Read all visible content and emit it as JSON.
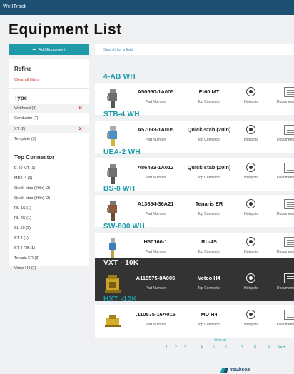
{
  "app": {
    "title": "WellTrack"
  },
  "page": {
    "title": "Equipment List"
  },
  "actions": {
    "add_label": "Add Equipment"
  },
  "search": {
    "placeholder": "Search for a field"
  },
  "refine": {
    "title": "Refine",
    "clear_label": "Clear all filters",
    "type": {
      "title": "Type",
      "items": [
        {
          "label": "Wellhead (8)",
          "selected": true
        },
        {
          "label": "Conductor (7)",
          "selected": false
        },
        {
          "label": "XT (2)",
          "selected": true
        },
        {
          "label": "Template (3)",
          "selected": false
        }
      ]
    },
    "top_connector": {
      "title": "Top Connector",
      "items": [
        "E-60 MT (1)",
        "MD H4 (1)",
        "Quick-stab (20in) (2)",
        "Quick-stab (30in) (2)",
        "RL-1S (1)",
        "RL-4S (1)",
        "SL-60 (3)",
        "ST-2 (1)",
        "ST-2 RB (1)",
        "Tenaris ER (3)",
        "Vetco H4 (1)"
      ]
    }
  },
  "labels": {
    "part_number": "Part Number",
    "top_connector": "Top Connector",
    "hotspots": "Hotspots",
    "documents": "Documents"
  },
  "equipment": [
    {
      "name": "4-AB WH",
      "part_number": "A50550-1A005",
      "connector": "E-60 MT",
      "selected": false,
      "thumb": "wellhead-grey"
    },
    {
      "name": "STB-4 WH",
      "part_number": "A57093-1A005",
      "connector": "Quick-stab (20in)",
      "selected": false,
      "thumb": "wellhead-yellow"
    },
    {
      "name": "UEA-2 WH",
      "part_number": "A86483-1A012",
      "connector": "Quick-stab (20in)",
      "selected": false,
      "thumb": "wellhead-grey"
    },
    {
      "name": "BS-8 WH",
      "part_number": "A13654-36A21",
      "connector": "Tenaris ER",
      "selected": false,
      "thumb": "wellhead-rust"
    },
    {
      "name": "SW-800 WH",
      "part_number": "H50160-1",
      "connector": "RL-4S",
      "selected": false,
      "thumb": "wellhead-blue"
    },
    {
      "name": "VXT - 10K",
      "part_number": "A110575-8A005",
      "connector": "Vetco H4",
      "selected": true,
      "thumb": "tree-yellow"
    },
    {
      "name": "HXT -10K",
      "part_number": ".110575-16A015",
      "connector": "MD H4",
      "selected": false,
      "thumb": "tree-yellow-flat"
    }
  ],
  "pagination": {
    "view_all": "View all",
    "pages": [
      "1",
      "2",
      "3",
      "4",
      "5",
      "6",
      "7",
      "8",
      "9"
    ],
    "next": "Next"
  },
  "brand": {
    "name": "4subsea"
  },
  "colors": {
    "header": "#1d4f73",
    "accent": "#1a9aa8",
    "danger": "#c0392b",
    "selected_card": "#333333"
  }
}
